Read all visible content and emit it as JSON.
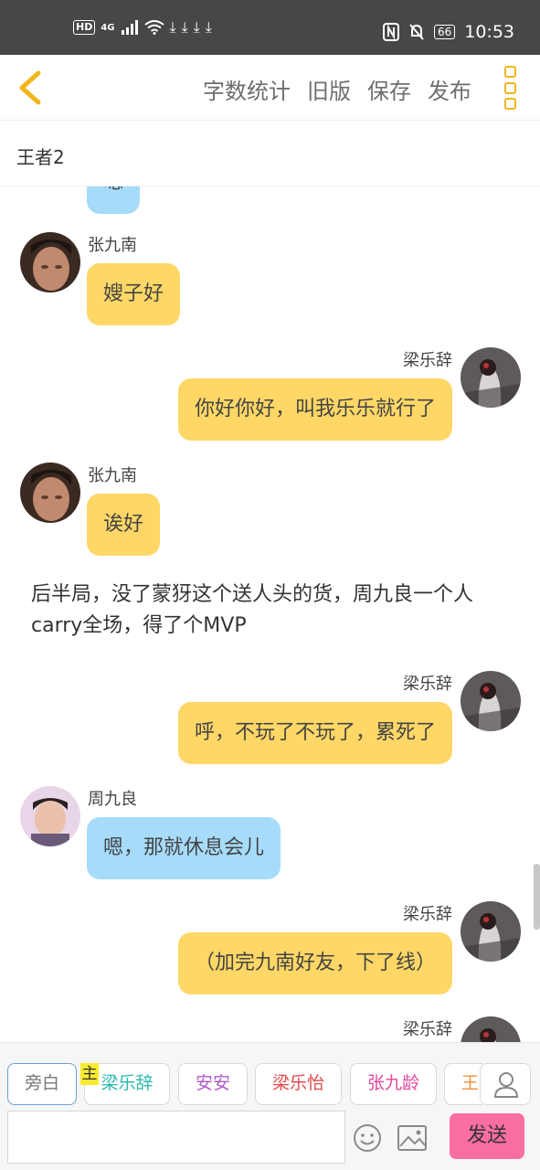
{
  "status_bar": {
    "hd": "HD",
    "signal": "4G",
    "battery": "66",
    "time": "10:53"
  },
  "toolbar": {
    "actions": [
      "字数统计",
      "旧版",
      "保存",
      "发布"
    ]
  },
  "chapter": {
    "title": "王者2"
  },
  "messages": [
    {
      "type": "bubble",
      "side": "left",
      "color": "blue",
      "name": "",
      "text": "嗯",
      "partial": true
    },
    {
      "type": "bubble",
      "side": "left",
      "color": "yellow",
      "name": "张九南",
      "text": "嫂子好"
    },
    {
      "type": "bubble",
      "side": "right",
      "color": "yellow",
      "name": "梁乐辞",
      "text": "你好你好，叫我乐乐就行了"
    },
    {
      "type": "bubble",
      "side": "left",
      "color": "yellow",
      "name": "张九南",
      "text": "诶好"
    },
    {
      "type": "narration",
      "text": "后半局，没了蒙犽这个送人头的货，周九良一个人carry全场，得了个MVP"
    },
    {
      "type": "bubble",
      "side": "right",
      "color": "yellow",
      "name": "梁乐辞",
      "text": "呼，不玩了不玩了，累死了"
    },
    {
      "type": "bubble",
      "side": "left",
      "color": "blue",
      "name": "周九良",
      "text": "嗯，那就休息会儿"
    },
    {
      "type": "bubble",
      "side": "right",
      "color": "yellow",
      "name": "梁乐辞",
      "text": "（加完九南好友，下了线）"
    },
    {
      "type": "name-only",
      "side": "right",
      "name": "梁乐辞"
    }
  ],
  "bottom": {
    "chips": [
      {
        "label": "旁白",
        "color": "#888888"
      },
      {
        "label": "梁乐辞",
        "color": "#2bb9b0"
      },
      {
        "label": "安安",
        "color": "#b05ac8"
      },
      {
        "label": "梁乐怡",
        "color": "#e24a4a"
      },
      {
        "label": "张九龄",
        "color": "#e2489a"
      },
      {
        "label": "王",
        "color": "#f0903a"
      }
    ],
    "main_tag": "主",
    "input_placeholder": "",
    "send_label": "发送"
  },
  "colors": {
    "bubble_yellow": "#fed766",
    "bubble_blue": "#a6dcfa",
    "send_button": "#fb6ea2",
    "accent": "#f2b51c"
  }
}
